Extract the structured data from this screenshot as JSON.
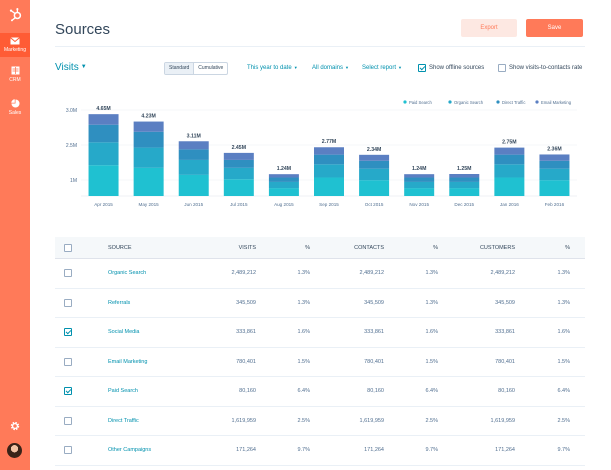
{
  "sidebar": {
    "items": [
      {
        "label": "Marketing",
        "icon": "mail-icon",
        "active": true
      },
      {
        "label": "CRM",
        "icon": "crm-icon",
        "active": false
      },
      {
        "label": "Sales",
        "icon": "pie-chart-icon",
        "active": false
      }
    ]
  },
  "header": {
    "title": "Sources",
    "export_label": "Export",
    "save_label": "Save"
  },
  "toolbar": {
    "metric_label": "Visits",
    "view_options": [
      "Standard",
      "Cumulative"
    ],
    "date_range": "This year to date",
    "domains": "All domains",
    "report": "Select report",
    "offline_label": "Show offline sources",
    "offline_checked": true,
    "rate_label": "Show visits-to-contacts rate",
    "rate_checked": false
  },
  "chart_data": {
    "type": "bar",
    "stacked": true,
    "categories": [
      "Apr 2015",
      "May 2015",
      "Jun 2015",
      "Jul 2015",
      "Aug 2015",
      "Sep 2015",
      "Oct 2015",
      "Nov 2015",
      "Dec 2015",
      "Jan 2016",
      "Feb 2016"
    ],
    "totals_labels": [
      "4.65M",
      "4.23M",
      "3.11M",
      "2.45M",
      "1.24M",
      "2.77M",
      "2.34M",
      "1.24M",
      "1.25M",
      "2.75M",
      "2.36M"
    ],
    "series": [
      {
        "name": "Paid Search",
        "color": "#1fc1d1",
        "values": [
          1.75,
          1.6,
          1.2,
          0.95,
          0.45,
          1.05,
          0.9,
          0.45,
          0.45,
          1.05,
          0.9
        ]
      },
      {
        "name": "Organic Search",
        "color": "#26a9c9",
        "values": [
          1.3,
          1.15,
          0.85,
          0.65,
          0.35,
          0.75,
          0.65,
          0.35,
          0.35,
          0.75,
          0.65
        ]
      },
      {
        "name": "Direct Traffic",
        "color": "#2f8fc0",
        "values": [
          1.0,
          0.9,
          0.6,
          0.45,
          0.25,
          0.55,
          0.45,
          0.25,
          0.25,
          0.55,
          0.45
        ]
      },
      {
        "name": "Email Marketing",
        "color": "#5b7fc2",
        "values": [
          0.6,
          0.58,
          0.46,
          0.4,
          0.19,
          0.42,
          0.34,
          0.19,
          0.2,
          0.4,
          0.36
        ]
      }
    ],
    "yticks": [
      "3.0M",
      "2.5M",
      "1M"
    ],
    "ylim": [
      0,
      5
    ],
    "legend_position": "top-right"
  },
  "table": {
    "headers": [
      "Source",
      "Visits",
      "%",
      "Contacts",
      "%",
      "Customers",
      "%"
    ],
    "rows": [
      {
        "checked": false,
        "source": "Organic Search",
        "visits": "2,489,212",
        "visits_pct": "1.3%",
        "contacts": "2,489,212",
        "contacts_pct": "1.3%",
        "customers": "2,489,212",
        "customers_pct": "1.3%"
      },
      {
        "checked": false,
        "source": "Referrals",
        "visits": "345,509",
        "visits_pct": "1.3%",
        "contacts": "345,509",
        "contacts_pct": "1.3%",
        "customers": "345,509",
        "customers_pct": "1.3%"
      },
      {
        "checked": true,
        "source": "Social Media",
        "visits": "333,861",
        "visits_pct": "1.6%",
        "contacts": "333,861",
        "contacts_pct": "1.6%",
        "customers": "333,861",
        "customers_pct": "1.6%"
      },
      {
        "checked": false,
        "source": "Email Marketing",
        "visits": "780,401",
        "visits_pct": "1.5%",
        "contacts": "780,401",
        "contacts_pct": "1.5%",
        "customers": "780,401",
        "customers_pct": "1.5%"
      },
      {
        "checked": true,
        "source": "Paid Search",
        "visits": "80,160",
        "visits_pct": "6.4%",
        "contacts": "80,160",
        "contacts_pct": "6.4%",
        "customers": "80,160",
        "customers_pct": "6.4%"
      },
      {
        "checked": false,
        "source": "Direct Traffic",
        "visits": "1,619,959",
        "visits_pct": "2.5%",
        "contacts": "1,619,959",
        "contacts_pct": "2.5%",
        "customers": "1,619,959",
        "customers_pct": "2.5%"
      },
      {
        "checked": false,
        "source": "Other Campaigns",
        "visits": "171,264",
        "visits_pct": "9.7%",
        "contacts": "171,264",
        "contacts_pct": "9.7%",
        "customers": "171,264",
        "customers_pct": "9.7%"
      }
    ]
  }
}
